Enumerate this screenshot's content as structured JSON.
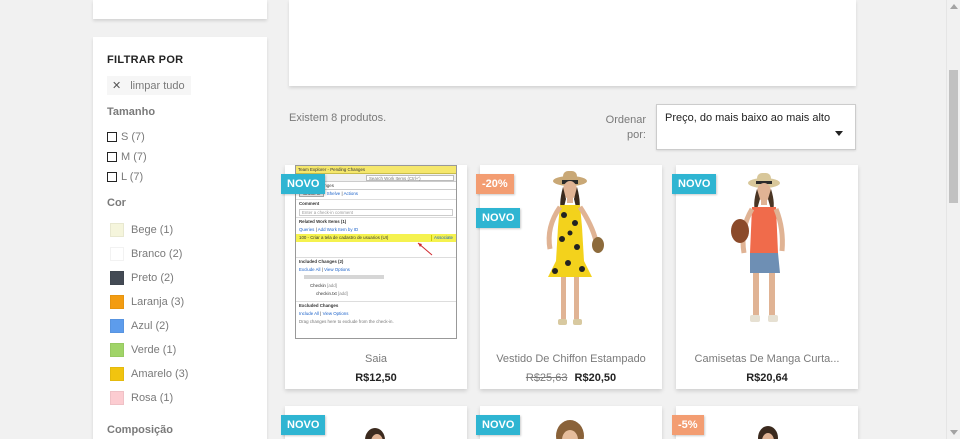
{
  "filters": {
    "title": "FILTRAR POR",
    "clear_label": "limpar tudo",
    "size_title": "Tamanho",
    "sizes": [
      {
        "label": "S (7)"
      },
      {
        "label": "M (7)"
      },
      {
        "label": "L (7)"
      }
    ],
    "color_title": "Cor",
    "colors": [
      {
        "label": "Bege (1)",
        "hex": "#f5f5dc"
      },
      {
        "label": "Branco (2)",
        "hex": "#ffffff"
      },
      {
        "label": "Preto (2)",
        "hex": "#434a54"
      },
      {
        "label": "Laranja (3)",
        "hex": "#f39c11"
      },
      {
        "label": "Azul (2)",
        "hex": "#5d9cec"
      },
      {
        "label": "Verde (1)",
        "hex": "#a0d468"
      },
      {
        "label": "Amarelo (3)",
        "hex": "#f1c40f"
      },
      {
        "label": "Rosa (1)",
        "hex": "#fcccd1"
      }
    ],
    "composition_title": "Composição"
  },
  "listing": {
    "count_text": "Existem 8 produtos.",
    "sort_label": "Ordenar por:",
    "sort_value": "Preço, do mais baixo ao mais alto"
  },
  "products": [
    {
      "name": "Saia",
      "price": "R$12,50",
      "old_price": "",
      "flags": [
        "NOVO"
      ],
      "image": "software-screenshot"
    },
    {
      "name": "Vestido De Chiffon Estampado",
      "price": "R$20,50",
      "old_price": "R$25,63",
      "flags": [
        "-20%",
        "NOVO"
      ],
      "image": "woman-yellow-dress"
    },
    {
      "name": "Camisetas De Manga Curta...",
      "price": "R$20,64",
      "old_price": "",
      "flags": [
        "NOVO"
      ],
      "image": "woman-orange-top"
    }
  ],
  "products_row2": [
    {
      "flags": [
        "NOVO"
      ]
    },
    {
      "flags": [
        "NOVO"
      ]
    },
    {
      "flags": [
        "-5%"
      ]
    }
  ],
  "screenshot_image": {
    "title": "Team Explorer - Pending Changes",
    "search": "Search Work Items (Ctrl+')",
    "tab": "Pending Changes",
    "check_in": "Check In",
    "shelve": "Shelve",
    "actions": "Actions",
    "comment_label": "Comment",
    "comment_placeholder": "Enter a check-in comment",
    "related_label": "Related Work Items (1)",
    "queries": "Queries",
    "add_work_item": "Add Work Item by ID",
    "work_item": "100 - Criar a tela de cadastro de usuarios (UI)",
    "associate": "Associate",
    "included_label": "Included Changes (2)",
    "exclude_all": "Exclude All",
    "view_options": "View Options",
    "checkin_file": "Checkin",
    "add1": "[add]",
    "checkin_file2": "checkin.txt",
    "add2": "[add]",
    "excluded_label": "Excluded Changes",
    "include_all": "Include All",
    "view_options2": "View Options",
    "drag_hint": "Drag changes here to exclude from the check-in."
  },
  "colors": {
    "new_flag": "#2fb5d2",
    "discount_flag": "#f39d72"
  }
}
